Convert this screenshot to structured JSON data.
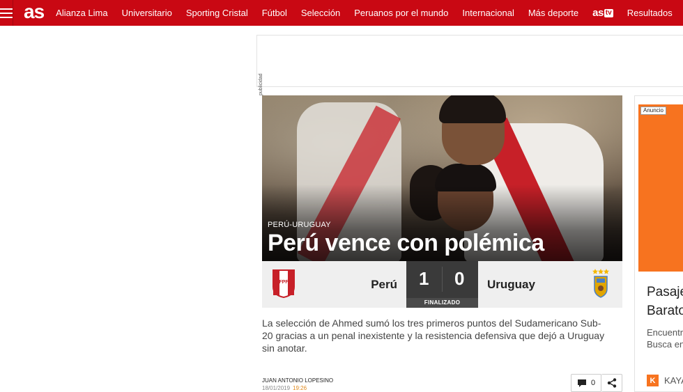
{
  "header": {
    "logo": "as",
    "nav": [
      "Alianza Lima",
      "Universitario",
      "Sporting Cristal",
      "Fútbol",
      "Selección",
      "Peruanos por el mundo",
      "Internacional",
      "Más deporte"
    ],
    "astv_as": "as",
    "astv_tv": "tv",
    "results": "Resultados"
  },
  "ad_top": {
    "label": "publicidad"
  },
  "article": {
    "kicker": "PERÚ-URUGUAY",
    "headline": "Perú vence con polémica",
    "summary": "La selección de Ahmed sumó los tres primeros puntos del Sudamericano Sub-20 gracias a un penal inexistente y la resistencia defensiva que dejó a Uruguay sin anotar.",
    "author": "JUAN ANTONIO LOPESINO",
    "date": "18/01/2019",
    "time": "19:26",
    "comments_count": "0"
  },
  "match": {
    "home": "Perú",
    "away": "Uruguay",
    "home_goals": "1",
    "away_goals": "0",
    "status": "FINALIZADO",
    "home_crest_letters": "FPF"
  },
  "right_ad": {
    "label": "Anuncio",
    "title_line1": "Pasaje",
    "title_line2": "Barato",
    "text_line1": "Encuentr",
    "text_line2": "Busca en",
    "brand_initial": "K",
    "brand_name": "KAYA"
  },
  "colors": {
    "brand_red": "#c90813",
    "orange": "#f7731f",
    "time": "#e2891a"
  }
}
